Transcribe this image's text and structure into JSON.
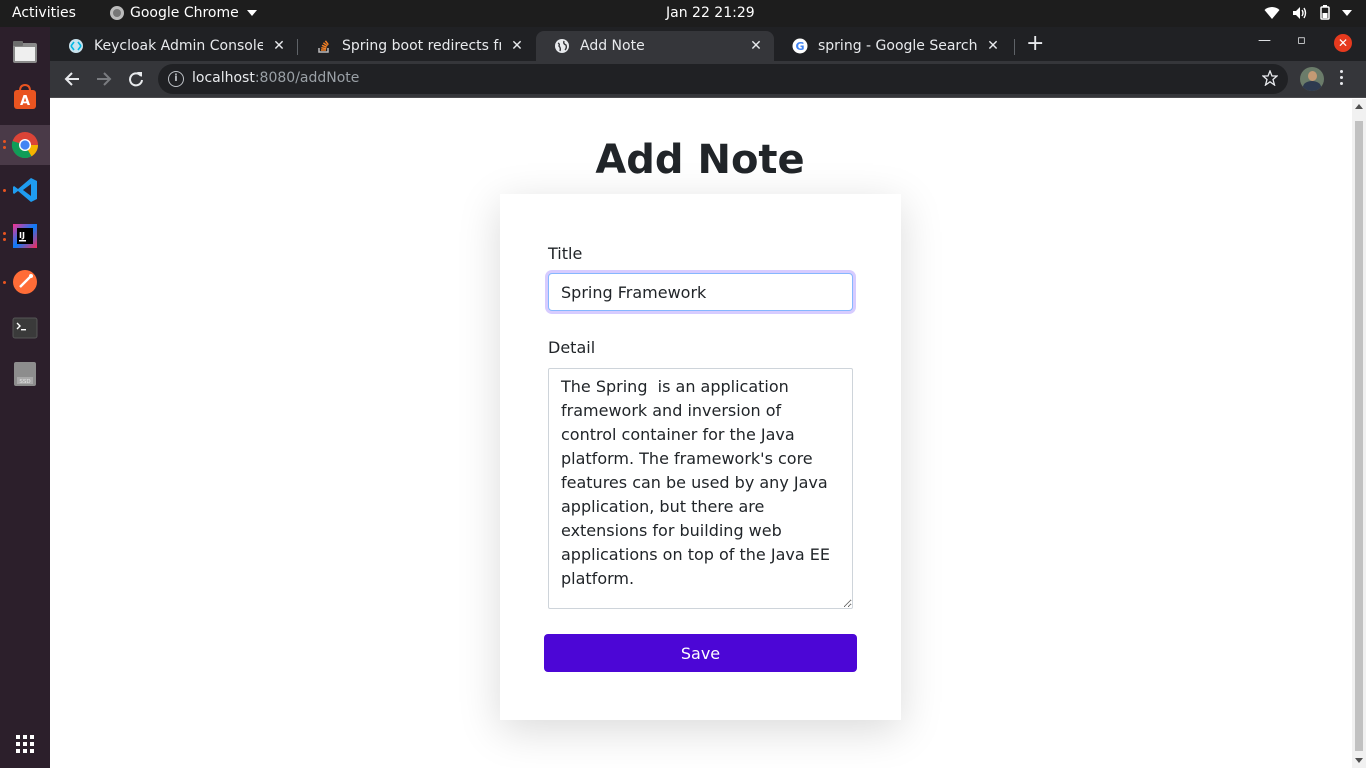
{
  "topbar": {
    "activities": "Activities",
    "app_name": "Google Chrome",
    "clock": "Jan 22  21:29"
  },
  "dock": {
    "items": [
      "files-icon",
      "ubuntu-software-icon",
      "chrome-icon",
      "vscode-icon",
      "intellij-icon",
      "postman-icon",
      "terminal-icon",
      "disk-icon"
    ],
    "show_apps": "show-apps-icon"
  },
  "browser": {
    "tabs": [
      {
        "title": "Keycloak Admin Console",
        "active": false
      },
      {
        "title": "Spring boot redirects from",
        "active": false
      },
      {
        "title": "Add Note",
        "active": true
      },
      {
        "title": "spring - Google Search",
        "active": false
      }
    ],
    "url_host": "localhost",
    "url_path": ":8080/addNote"
  },
  "page": {
    "heading": "Add Note",
    "title_label": "Title",
    "title_value": "Spring Framework",
    "detail_label": "Detail",
    "detail_value": "The Spring  is an application framework and inversion of control container for the Java platform. The framework's core features can be used by any Java application, but there are extensions for building web applications on top of the Java EE platform.",
    "save_label": "Save"
  },
  "colors": {
    "accent": "#4c06d6",
    "dock_bg": "#2c1f2b",
    "chrome_dark": "#202124"
  }
}
